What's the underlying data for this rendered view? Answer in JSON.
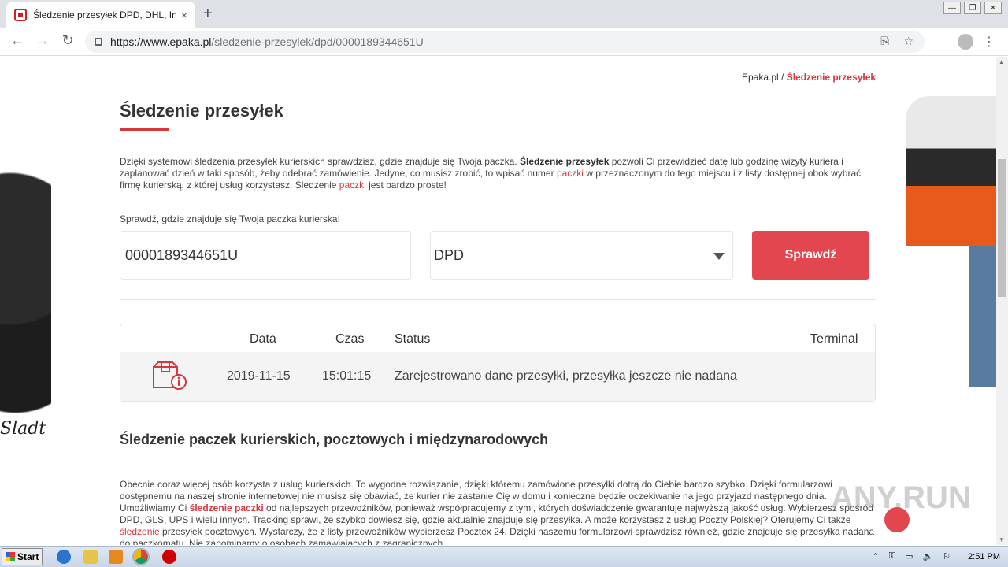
{
  "browser": {
    "tab_title": "Śledzenie przesyłek DPD, DHL, InPo",
    "tab_close": "×",
    "new_tab": "+",
    "url_host": "https://www.epaka.pl",
    "url_path": "/sledzenie-przesylek/dpd/0000189344651U",
    "back": "←",
    "forward": "→",
    "reload": "↻",
    "translate_icon": "⎘",
    "bookmark_star": "☆",
    "menu": "⋮",
    "win_min": "—",
    "win_max": "❐",
    "win_close": "✕"
  },
  "breadcrumb": {
    "root": "Epaka.pl",
    "sep": " / ",
    "current": "Śledzenie przesyłek"
  },
  "page_title": "Śledzenie przesyłek",
  "intro": {
    "part1": "Dzięki systemowi śledzenia przesyłek kurierskich sprawdzisz, gdzie znajduje się Twoja paczka. ",
    "bold": "Śledzenie przesyłek",
    "part2": " pozwoli Ci przewidzieć datę lub godzinę wizyty kuriera i zaplanować dzień w taki sposób, żeby odebrać zamówienie. Jedyne, co musisz zrobić, to wpisać numer ",
    "link1": "paczki",
    "part3": " w przeznaczonym do tego miejscu i z listy dostępnej obok wybrać firmę kurierską, z której usług korzystasz. Śledzenie ",
    "link2": "paczki",
    "part4": " jest bardzo proste!"
  },
  "form": {
    "label": "Sprawdź, gdzie znajduje się Twoja paczka kurierska!",
    "tracking_number": "0000189344651U",
    "carrier": "DPD",
    "submit": "Sprawdź"
  },
  "results": {
    "headers": [
      "Data",
      "Czas",
      "Status",
      "Terminal"
    ],
    "rows": [
      {
        "date": "2019-11-15",
        "time": "15:01:15",
        "status": "Zarejestrowano dane przesyłki, przesyłka jeszcze nie nadana",
        "terminal": ""
      }
    ]
  },
  "section2": {
    "title": "Śledzenie paczek kurierskich, pocztowych i międzynarodowych",
    "p1": "Obecnie coraz więcej osób korzysta z usług kurierskich. To wygodne rozwiązanie, dzięki któremu zamówione przesyłki dotrą do Ciebie bardzo szybko. Dzięki formularzowi dostępnemu na naszej stronie internetowej nie musisz się obawiać, że kurier nie zastanie Cię w domu i konieczne będzie oczekiwanie na jego przyjazd następnego dnia. Umożliwiamy Ci ",
    "link1": "śledzenie paczki",
    "p2": " od najlepszych przewoźników, ponieważ współpracujemy z tymi, których doświadczenie gwarantuje najwyższą jakość usług. Wybierzesz spośród DPD, GLS, UPS i wielu innych. Tracking sprawi, że szybko dowiesz się, gdzie aktualnie znajduje się przesyłka. A może korzystasz z usług Poczty Polskiej? Oferujemy Ci także ",
    "link2": "śledzenie",
    "p3": " przesyłek pocztowych. Wystarczy, że z listy przewoźników wybierzesz Pocztex 24. Dzięki naszemu formularzowi sprawdzisz również, gdzie znajduje się przesyłka nadana do paczkomatu. Nie zapominamy o osobach zamawiających z zagranicznych"
  },
  "decor": {
    "signature": "Sladt",
    "watermark": "ANY.RUN"
  },
  "taskbar": {
    "start": "Start",
    "clock": "2:51 PM"
  }
}
